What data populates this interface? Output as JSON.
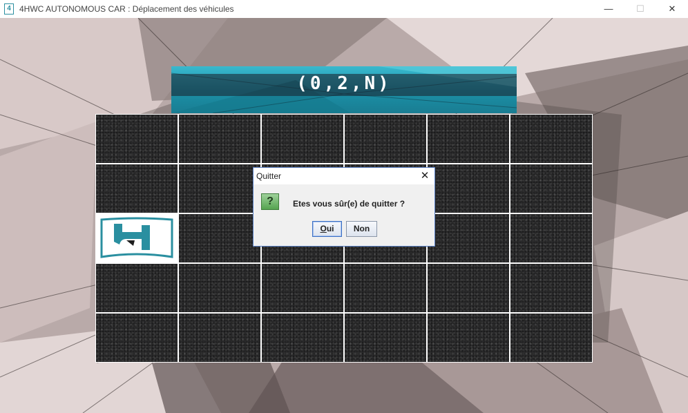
{
  "window": {
    "title": "4HWC AUTONOMOUS CAR : Déplacement des véhicules",
    "app_icon_glyph": "4",
    "minimize_glyph": "—",
    "maximize_glyph": "☐",
    "close_glyph": "✕"
  },
  "banner": {
    "position_text": "(0,2,N)"
  },
  "grid": {
    "rows": 5,
    "cols": 6,
    "car_cell": {
      "row": 2,
      "col": 0
    }
  },
  "dialog": {
    "title": "Quitter",
    "close_glyph": "✕",
    "icon_glyph": "?",
    "message": "Etes vous sûr(e) de quitter ?",
    "buttons": {
      "yes_first": "O",
      "yes_rest": "ui",
      "no": "Non"
    }
  },
  "colors": {
    "banner_teal": "#2aa6bc",
    "dialog_border": "#5a82c8",
    "question_icon": "#55a450"
  }
}
